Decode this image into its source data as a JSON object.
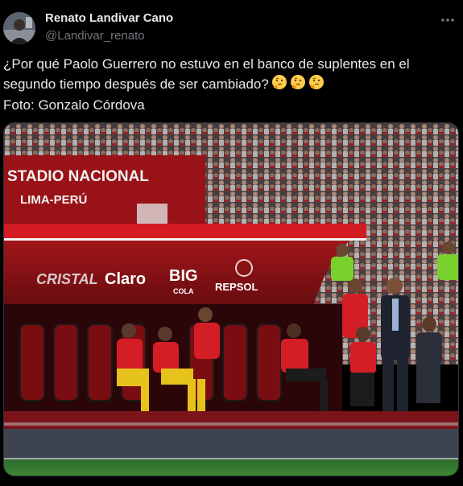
{
  "author": {
    "name": "Renato Landivar Cano",
    "handle": "@Landivar_renato",
    "avatar_icon": "avatar-photo"
  },
  "tweet": {
    "line1": "¿Por qué Paolo Guerrero no estuvo en el banco de suplentes en el",
    "line2": "segundo tiempo después de ser cambiado?",
    "emojis": [
      "thinking-face",
      "thinking-face",
      "thinking-face"
    ],
    "line3": "Foto: Gonzalo Córdova"
  },
  "media": {
    "stadium_text_1": "STADIO NACIONAL",
    "stadium_text_2": "LIMA-PERÚ",
    "sponsor_1": "CRISTAL",
    "sponsor_2": "Claro",
    "sponsor_3": "BIG",
    "sponsor_3b": "COLA",
    "sponsor_4": "REPSOL"
  },
  "more_icon": "more-horizontal-icon",
  "colors": {
    "background": "#000000",
    "text": "#e7e9ea",
    "muted": "#71767b",
    "bench_red": "#c41a1a",
    "pitch_green": "#2e7d32"
  }
}
